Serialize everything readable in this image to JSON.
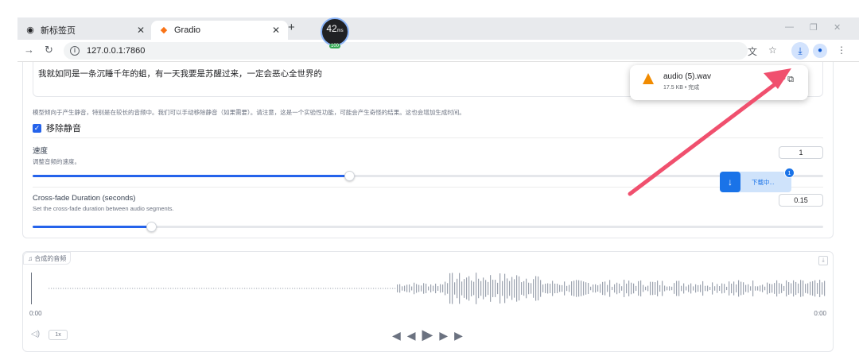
{
  "browser": {
    "tabs": [
      {
        "title": "新标签页",
        "icon": "chrome-icon"
      },
      {
        "title": "Gradio",
        "icon": "gradio-icon"
      }
    ],
    "url": "127.0.0.1:7860",
    "ping": {
      "ms": "42",
      "unit": "ms",
      "pct": "100"
    }
  },
  "form": {
    "text_value": "我就如同是一条沉睡千年的蛆，有一天我要是苏醒过来，一定会恶心全世界的",
    "silence_hint": "模型倾向于产生静音，特别是在较长的音频中。我们可以手动移除静音（如果需要）。请注意，这是一个实验性功能，可能会产生奇怪的结果。这也会增加生成时间。",
    "remove_silence_label": "移除静音",
    "remove_silence_checked": true,
    "speed_label": "速度",
    "speed_hint": "调整音频的速度。",
    "speed_value": "1",
    "speed_fill": 0.4,
    "crossfade_label": "Cross-fade Duration (seconds)",
    "crossfade_hint": "Set the cross-fade duration between audio segments.",
    "crossfade_value": "0.15",
    "crossfade_fill": 0.15
  },
  "audio": {
    "label": "合成的音频",
    "time_start": "0:00",
    "time_end": "0:00",
    "rate": "1x"
  },
  "download_popup": {
    "filename": "audio (5).wav",
    "meta": "17.5 KB • 完成"
  },
  "download_float": {
    "text": "下载中...",
    "count": "1"
  },
  "colors": {
    "accent": "#2563eb",
    "arrow": "#f0506e"
  }
}
